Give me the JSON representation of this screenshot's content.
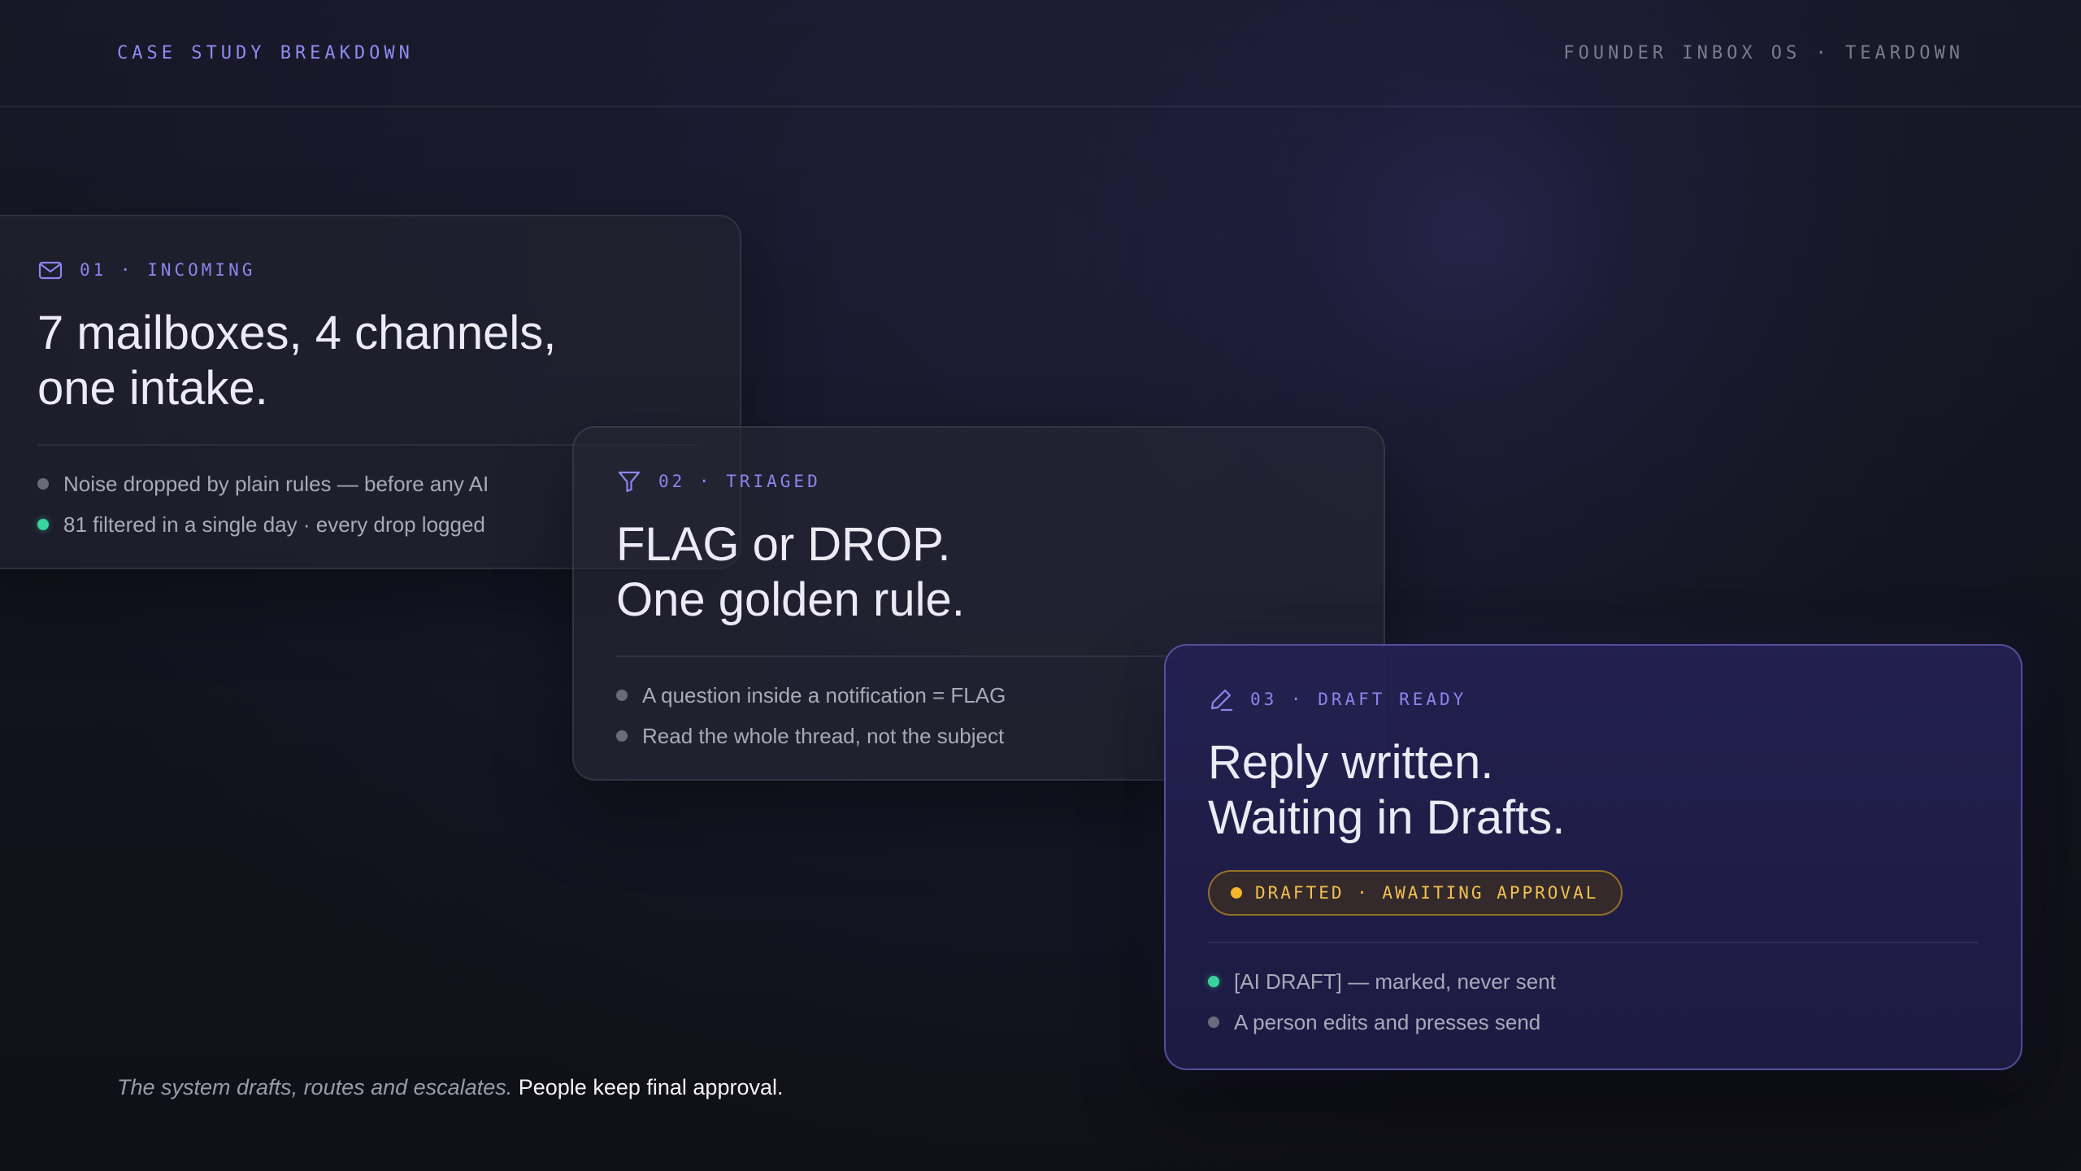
{
  "header": {
    "left_label": "CASE STUDY BREAKDOWN",
    "right_label": "FOUNDER INBOX OS · TEARDOWN"
  },
  "cards": [
    {
      "icon": "mail-icon",
      "step": "01 · INCOMING",
      "title_lines": [
        "7 mailboxes, 4 channels,",
        "one intake."
      ],
      "bullets": [
        {
          "text": "Noise dropped by plain rules — before any AI",
          "dot": "gray"
        },
        {
          "text": "81 filtered in a single day · every drop logged",
          "dot": "green"
        }
      ]
    },
    {
      "icon": "filter-icon",
      "step": "02 · TRIAGED",
      "title_lines": [
        "FLAG or DROP.",
        "One golden rule."
      ],
      "bullets": [
        {
          "text": "A question inside a notification = FLAG",
          "dot": "gray"
        },
        {
          "text": "Read the whole thread, not the subject",
          "dot": "gray"
        }
      ]
    },
    {
      "icon": "pen-icon",
      "step": "03 · DRAFT READY",
      "title_lines": [
        "Reply written.",
        "Waiting in Drafts."
      ],
      "status": "DRAFTED · AWAITING APPROVAL",
      "bullets": [
        {
          "text": "[AI DRAFT] — marked, never sent",
          "dot": "green"
        },
        {
          "text": "A person edits and presses send",
          "dot": "gray"
        }
      ]
    }
  ],
  "footer": {
    "italic": "The system drafts, routes and escalates.",
    "strong": "People keep final approval."
  },
  "colors": {
    "accent": "#8b86ee",
    "success": "#38d39f",
    "warning": "#f6b52a",
    "background": "#13131d"
  }
}
